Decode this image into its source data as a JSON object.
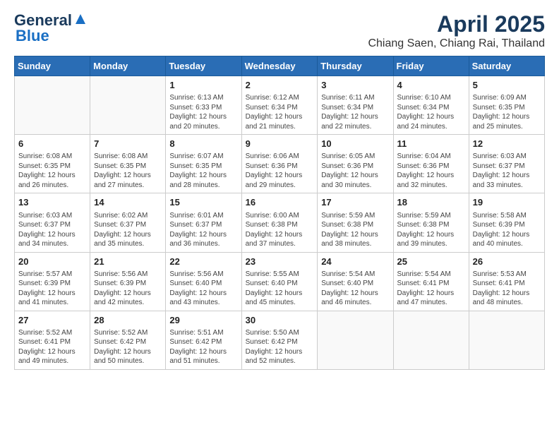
{
  "header": {
    "logo_line1": "General",
    "logo_line2": "Blue",
    "title": "April 2025",
    "subtitle": "Chiang Saen, Chiang Rai, Thailand"
  },
  "weekdays": [
    "Sunday",
    "Monday",
    "Tuesday",
    "Wednesday",
    "Thursday",
    "Friday",
    "Saturday"
  ],
  "weeks": [
    [
      {
        "day": "",
        "info": ""
      },
      {
        "day": "",
        "info": ""
      },
      {
        "day": "1",
        "info": "Sunrise: 6:13 AM\nSunset: 6:33 PM\nDaylight: 12 hours and 20 minutes."
      },
      {
        "day": "2",
        "info": "Sunrise: 6:12 AM\nSunset: 6:34 PM\nDaylight: 12 hours and 21 minutes."
      },
      {
        "day": "3",
        "info": "Sunrise: 6:11 AM\nSunset: 6:34 PM\nDaylight: 12 hours and 22 minutes."
      },
      {
        "day": "4",
        "info": "Sunrise: 6:10 AM\nSunset: 6:34 PM\nDaylight: 12 hours and 24 minutes."
      },
      {
        "day": "5",
        "info": "Sunrise: 6:09 AM\nSunset: 6:35 PM\nDaylight: 12 hours and 25 minutes."
      }
    ],
    [
      {
        "day": "6",
        "info": "Sunrise: 6:08 AM\nSunset: 6:35 PM\nDaylight: 12 hours and 26 minutes."
      },
      {
        "day": "7",
        "info": "Sunrise: 6:08 AM\nSunset: 6:35 PM\nDaylight: 12 hours and 27 minutes."
      },
      {
        "day": "8",
        "info": "Sunrise: 6:07 AM\nSunset: 6:35 PM\nDaylight: 12 hours and 28 minutes."
      },
      {
        "day": "9",
        "info": "Sunrise: 6:06 AM\nSunset: 6:36 PM\nDaylight: 12 hours and 29 minutes."
      },
      {
        "day": "10",
        "info": "Sunrise: 6:05 AM\nSunset: 6:36 PM\nDaylight: 12 hours and 30 minutes."
      },
      {
        "day": "11",
        "info": "Sunrise: 6:04 AM\nSunset: 6:36 PM\nDaylight: 12 hours and 32 minutes."
      },
      {
        "day": "12",
        "info": "Sunrise: 6:03 AM\nSunset: 6:37 PM\nDaylight: 12 hours and 33 minutes."
      }
    ],
    [
      {
        "day": "13",
        "info": "Sunrise: 6:03 AM\nSunset: 6:37 PM\nDaylight: 12 hours and 34 minutes."
      },
      {
        "day": "14",
        "info": "Sunrise: 6:02 AM\nSunset: 6:37 PM\nDaylight: 12 hours and 35 minutes."
      },
      {
        "day": "15",
        "info": "Sunrise: 6:01 AM\nSunset: 6:37 PM\nDaylight: 12 hours and 36 minutes."
      },
      {
        "day": "16",
        "info": "Sunrise: 6:00 AM\nSunset: 6:38 PM\nDaylight: 12 hours and 37 minutes."
      },
      {
        "day": "17",
        "info": "Sunrise: 5:59 AM\nSunset: 6:38 PM\nDaylight: 12 hours and 38 minutes."
      },
      {
        "day": "18",
        "info": "Sunrise: 5:59 AM\nSunset: 6:38 PM\nDaylight: 12 hours and 39 minutes."
      },
      {
        "day": "19",
        "info": "Sunrise: 5:58 AM\nSunset: 6:39 PM\nDaylight: 12 hours and 40 minutes."
      }
    ],
    [
      {
        "day": "20",
        "info": "Sunrise: 5:57 AM\nSunset: 6:39 PM\nDaylight: 12 hours and 41 minutes."
      },
      {
        "day": "21",
        "info": "Sunrise: 5:56 AM\nSunset: 6:39 PM\nDaylight: 12 hours and 42 minutes."
      },
      {
        "day": "22",
        "info": "Sunrise: 5:56 AM\nSunset: 6:40 PM\nDaylight: 12 hours and 43 minutes."
      },
      {
        "day": "23",
        "info": "Sunrise: 5:55 AM\nSunset: 6:40 PM\nDaylight: 12 hours and 45 minutes."
      },
      {
        "day": "24",
        "info": "Sunrise: 5:54 AM\nSunset: 6:40 PM\nDaylight: 12 hours and 46 minutes."
      },
      {
        "day": "25",
        "info": "Sunrise: 5:54 AM\nSunset: 6:41 PM\nDaylight: 12 hours and 47 minutes."
      },
      {
        "day": "26",
        "info": "Sunrise: 5:53 AM\nSunset: 6:41 PM\nDaylight: 12 hours and 48 minutes."
      }
    ],
    [
      {
        "day": "27",
        "info": "Sunrise: 5:52 AM\nSunset: 6:41 PM\nDaylight: 12 hours and 49 minutes."
      },
      {
        "day": "28",
        "info": "Sunrise: 5:52 AM\nSunset: 6:42 PM\nDaylight: 12 hours and 50 minutes."
      },
      {
        "day": "29",
        "info": "Sunrise: 5:51 AM\nSunset: 6:42 PM\nDaylight: 12 hours and 51 minutes."
      },
      {
        "day": "30",
        "info": "Sunrise: 5:50 AM\nSunset: 6:42 PM\nDaylight: 12 hours and 52 minutes."
      },
      {
        "day": "",
        "info": ""
      },
      {
        "day": "",
        "info": ""
      },
      {
        "day": "",
        "info": ""
      }
    ]
  ]
}
